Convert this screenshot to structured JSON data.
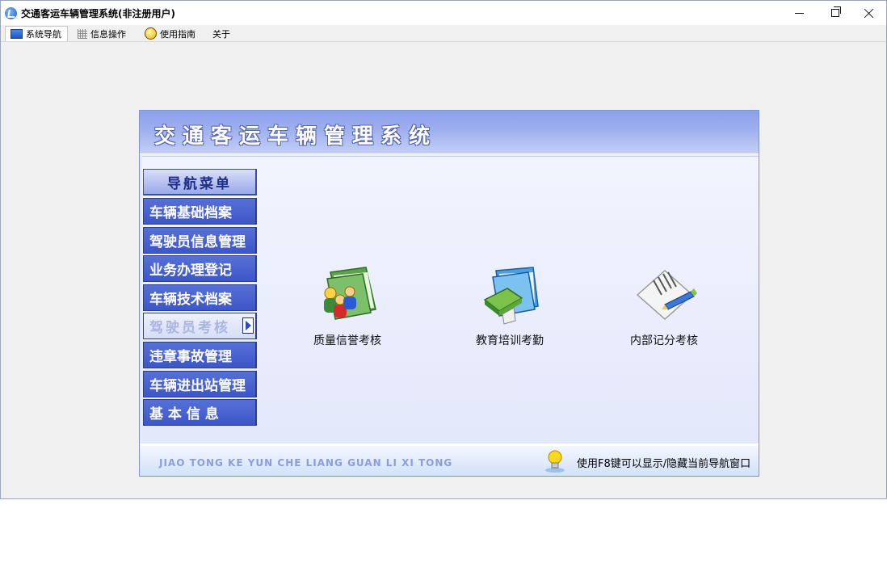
{
  "window": {
    "title": "交通客运车辆管理系统(非注册用户)",
    "controls": {
      "minimize": "minimize-icon",
      "maximize": "restore-icon",
      "close": "close-icon"
    }
  },
  "tabs": [
    {
      "label": "系统导航",
      "icon": "monitor-icon",
      "active": true
    },
    {
      "label": "信息操作",
      "icon": "grid-icon",
      "active": false
    },
    {
      "label": "使用指南",
      "icon": "guide-icon",
      "active": false
    },
    {
      "label": "关于",
      "icon": "",
      "active": false
    }
  ],
  "panel": {
    "title": "交通客运车辆管理系统",
    "nav": {
      "header": "导航菜单",
      "items": [
        {
          "label": "车辆基础档案"
        },
        {
          "label": "驾驶员信息管理"
        },
        {
          "label": "业务办理登记"
        },
        {
          "label": "车辆技术档案"
        },
        {
          "label": "驾驶员考核",
          "active": true
        },
        {
          "label": "违章事故管理"
        },
        {
          "label": "车辆进出站管理"
        },
        {
          "label": "基 本 信 息"
        }
      ]
    },
    "functions": [
      {
        "label": "质量信誉考核",
        "icon": "folder-people-icon"
      },
      {
        "label": "教育培训考勤",
        "icon": "folder-book-icon"
      },
      {
        "label": "内部记分考核",
        "icon": "document-pen-icon"
      }
    ],
    "footer": {
      "pinyin": "JIAO TONG KE YUN CHE LIANG GUAN LI XI TONG",
      "hint": "使用F8键可以显示/隐藏当前导航窗口",
      "icon": "lightbulb-icon"
    }
  },
  "colors": {
    "nav_item": "#4a63d0",
    "header": "#9fb0ef",
    "content_bg": "#e8ecfa"
  }
}
